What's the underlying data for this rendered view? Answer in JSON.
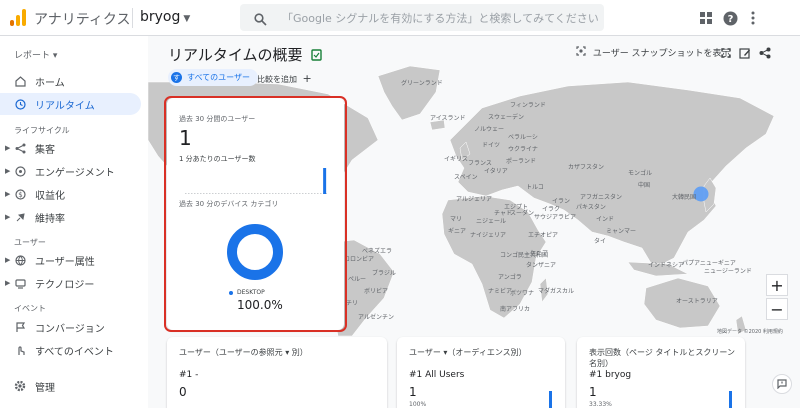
{
  "topbar": {
    "app_title": "アナリティクス",
    "property": "bryog",
    "search_placeholder": "「Google シグナルを有効にする方法」と検索してみてください"
  },
  "sidebar": {
    "report_label": "レポート",
    "items": [
      {
        "label": "ホーム",
        "icon": "home-icon"
      },
      {
        "label": "リアルタイム",
        "icon": "clock-icon",
        "active": true
      }
    ],
    "lifecycle_label": "ライフサイクル",
    "lifecycle_items": [
      {
        "label": "集客",
        "icon": "acquisition-icon"
      },
      {
        "label": "エンゲージメント",
        "icon": "engagement-icon"
      },
      {
        "label": "収益化",
        "icon": "dollar-icon"
      },
      {
        "label": "維持率",
        "icon": "retention-icon"
      }
    ],
    "user_label": "ユーザー",
    "user_items": [
      {
        "label": "ユーザー属性",
        "icon": "globe-icon"
      },
      {
        "label": "テクノロジー",
        "icon": "devices-icon"
      }
    ],
    "event_label": "イベント",
    "event_items": [
      {
        "label": "コンバージョン",
        "icon": "flag-icon"
      },
      {
        "label": "すべてのイベント",
        "icon": "touch-icon"
      }
    ],
    "admin_label": "管理"
  },
  "main": {
    "page_title": "リアルタイムの概要",
    "chip_label": "すべてのユーザー",
    "chip_letter": "す",
    "add_comparison": "比較を追加",
    "snapshot_label": "ユーザー スナップショットを表示"
  },
  "map": {
    "labels": [
      "グリーンランド",
      "アイスランド",
      "フィンランド",
      "スウェーデン",
      "ノルウェー",
      "ベラルーシ",
      "ウクライナ",
      "イギリス",
      "ドイツ",
      "フランス",
      "スペイン",
      "イタリア",
      "ポーランド",
      "カザフスタン",
      "モンゴル",
      "中国",
      "トルコ",
      "イラン",
      "アフガニスタン",
      "パキスタン",
      "インド",
      "サウジアラビア",
      "エジプト",
      "アルジェリア",
      "マリ",
      "ニジェール",
      "チャド",
      "スーダン",
      "エチオピア",
      "ナイジェリア",
      "ケニア",
      "コンゴ民主共和国",
      "タンザニア",
      "アンゴラ",
      "ナミビア",
      "ボツワナ",
      "南アフリカ",
      "マダガスカル",
      "ベネズエラ",
      "コロンビア",
      "ペルー",
      "ブラジル",
      "ボリビア",
      "チリ",
      "アルゼンチン",
      "パプアニューギニア",
      "インドネシア",
      "オーストラリア",
      "ニュージーランド",
      "大韓民国",
      "ミャンマー",
      "タイ",
      "イラク",
      "ギニア"
    ],
    "attribution": "地図データ ©2020   利用規約"
  },
  "realtime_card": {
    "users_label": "過去 30 分間のユーザー",
    "users_value": "1",
    "per_minute_label": "1 分あたりのユーザー数",
    "device_label": "過去 30 分のデバイス カテゴリ",
    "legend_label": "DESKTOP",
    "percent": "100.0%",
    "sparkline": [
      0,
      0,
      0,
      0,
      0,
      0,
      0,
      0,
      0,
      0,
      0,
      0,
      0,
      0,
      0,
      0,
      0,
      0,
      0,
      0,
      0,
      0,
      0,
      0,
      0,
      0,
      0,
      0,
      0,
      1
    ]
  },
  "cards": [
    {
      "header": "ユーザー（ユーザーの参照元 ▾ 別）",
      "row": "#1  -",
      "value": "0",
      "pct": ""
    },
    {
      "header": "ユーザー ▾（オーディエンス別）",
      "row": "#1  All Users",
      "value": "1",
      "pct": "100%"
    },
    {
      "header": "表示回数（ページ タイトルとスクリーン名別）",
      "row": "#1  bryog",
      "value": "1",
      "pct": "33.33%"
    }
  ],
  "colors": {
    "accent": "#1a73e8",
    "highlight": "#d93025",
    "map_land": "#c8c8c8",
    "map_water": "#f8f9fa"
  }
}
